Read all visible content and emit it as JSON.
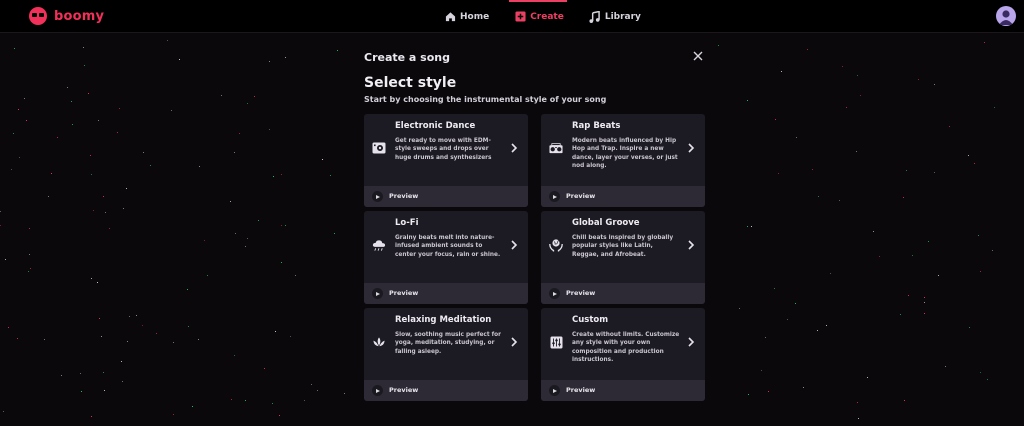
{
  "brand": {
    "name": "boomy",
    "accent": "#f2315a"
  },
  "nav": {
    "items": [
      {
        "label": "Home",
        "icon": "home-icon"
      },
      {
        "label": "Create",
        "icon": "plus-square-icon",
        "active": true
      },
      {
        "label": "Library",
        "icon": "music-note-icon"
      }
    ]
  },
  "modal": {
    "title": "Create a song",
    "heading": "Select style",
    "subheading": "Start by choosing the instrumental style of your song",
    "close_icon": "close-icon",
    "preview_label": "Preview",
    "styles": [
      {
        "title": "Electronic Dance",
        "description": "Get ready to move with EDM-style sweeps and drops over huge drums and synthesizers",
        "icon": "speaker-icon"
      },
      {
        "title": "Rap Beats",
        "description": "Modern beats influenced by Hip Hop and Trap. Inspire a new dance, layer your verses, or just nod along.",
        "icon": "boombox-icon"
      },
      {
        "title": "Lo-Fi",
        "description": "Grainy beats melt into nature-infused ambient sounds to center your focus, rain or shine.",
        "icon": "cloud-rain-icon"
      },
      {
        "title": "Global Groove",
        "description": "Chill beats inspired by globally popular styles like Latin, Reggae, and Afrobeat.",
        "icon": "globe-hands-icon"
      },
      {
        "title": "Relaxing Meditation",
        "description": "Slow, soothing music perfect for yoga, meditation, studying, or falling asleep.",
        "icon": "lotus-icon"
      },
      {
        "title": "Custom",
        "description": "Create without limits. Customize any style with your own composition and production instructions.",
        "icon": "sliders-icon"
      }
    ]
  },
  "colors": {
    "background": "#0b080c",
    "card": "#1c1a22",
    "preview_bar": "#2d2a36",
    "active_nav": "#ec3f64"
  }
}
